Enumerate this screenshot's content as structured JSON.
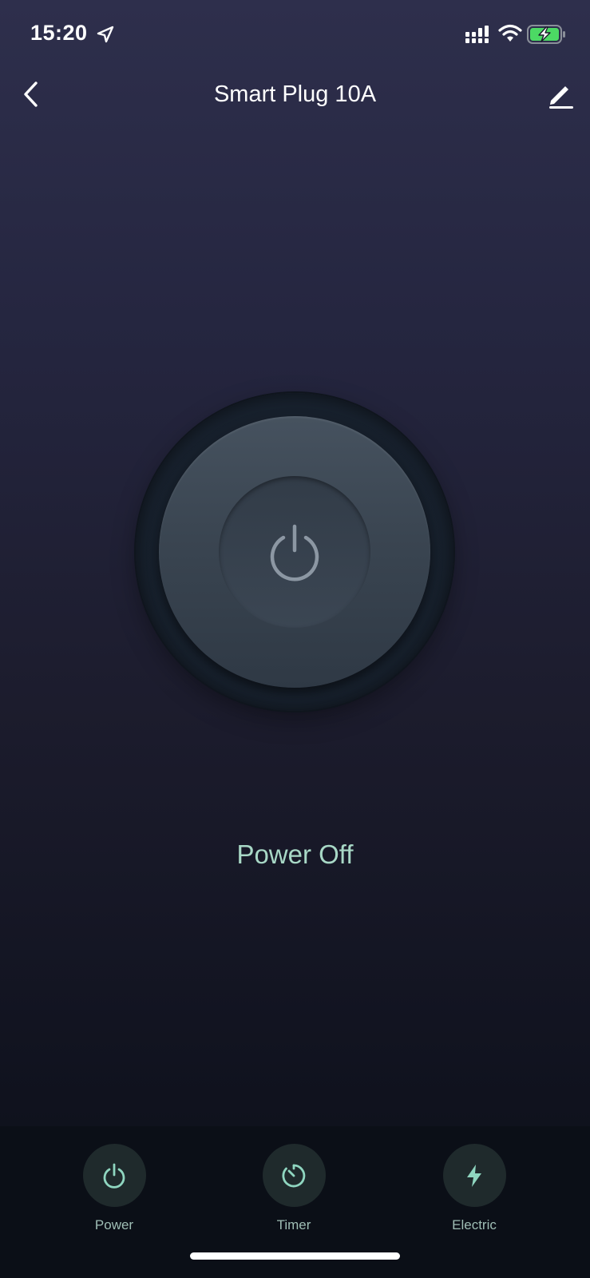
{
  "status_bar": {
    "time": "15:20"
  },
  "header": {
    "title": "Smart Plug 10A"
  },
  "device": {
    "status_text": "Power Off"
  },
  "bottom_tabs": [
    {
      "label": "Power",
      "icon": "power-icon"
    },
    {
      "label": "Timer",
      "icon": "timer-icon"
    },
    {
      "label": "Electric",
      "icon": "lightning-icon"
    }
  ],
  "colors": {
    "accent": "#a8d8c6",
    "tab_icon": "#8fd6c0",
    "battery_green": "#4cd964"
  }
}
